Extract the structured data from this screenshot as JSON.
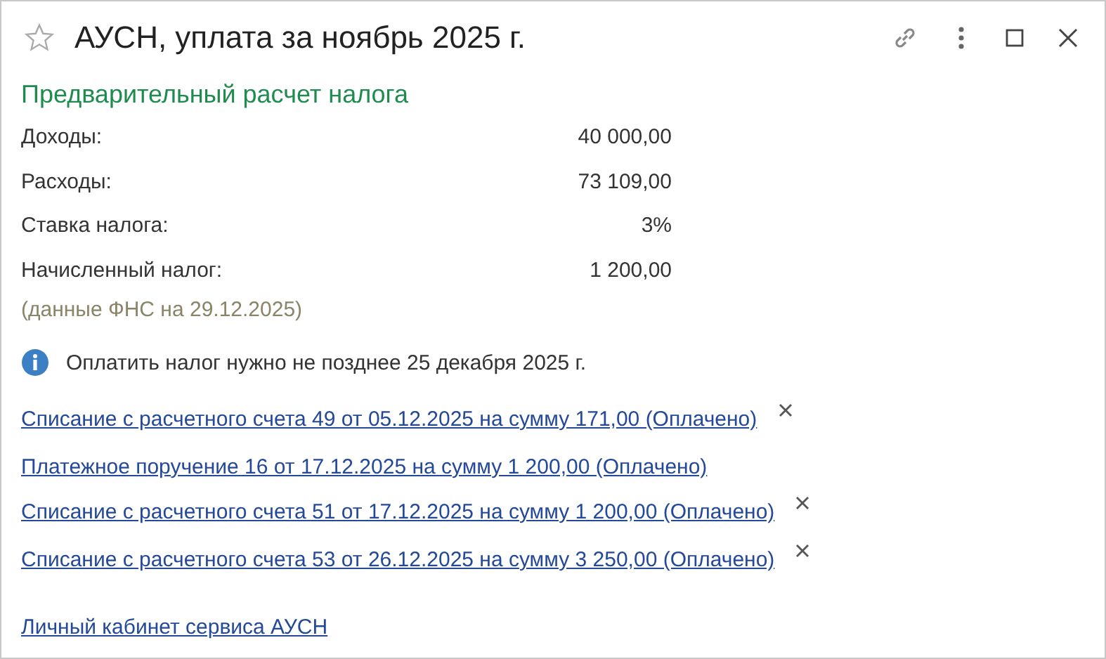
{
  "window": {
    "title": "АУСН, уплата за ноябрь 2025 г.",
    "favorite": false
  },
  "section": {
    "heading": "Предварительный расчет налога",
    "rows": [
      {
        "label": "Доходы:",
        "value": "40 000,00"
      },
      {
        "label": "Расходы:",
        "value": "73 109,00"
      },
      {
        "label": "Ставка налога:",
        "value": "3%"
      },
      {
        "label": "Начисленный налог:",
        "value": "1 200,00"
      }
    ],
    "source_note": "(данные ФНС на 29.12.2025)"
  },
  "info": "Оплатить налог нужно не позднее 25 декабря 2025 г.",
  "documents": [
    {
      "text": "Списание с расчетного счета 49 от 05.12.2025 на сумму 171,00 (Оплачено)",
      "removable": true
    },
    {
      "text": "Платежное поручение 16 от 17.12.2025 на сумму 1 200,00 (Оплачено)",
      "removable": false
    },
    {
      "text": "Списание с расчетного счета 51 от 17.12.2025 на сумму 1 200,00 (Оплачено)",
      "removable": true
    },
    {
      "text": "Списание с расчетного счета 53 от 26.12.2025 на сумму 3 250,00 (Оплачено)",
      "removable": true
    }
  ],
  "service_link": "Личный кабинет сервиса АУСН"
}
